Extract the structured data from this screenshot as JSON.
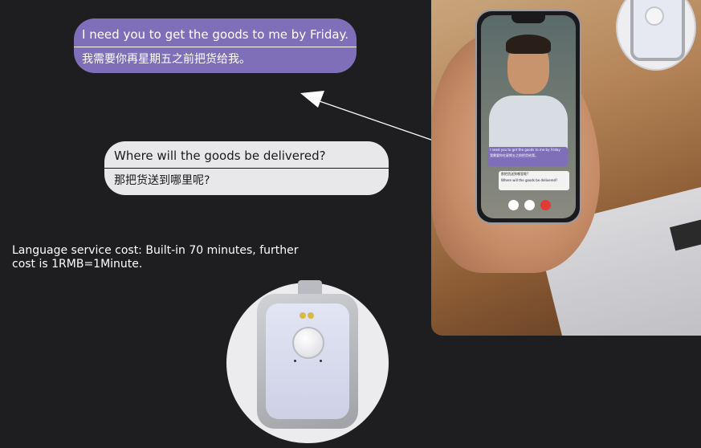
{
  "bubbles": {
    "outgoing": {
      "english": "I need you to get the goods to me by Friday.",
      "chinese": "我需要你再星期五之前把货给我。",
      "color": "#7e6fb8"
    },
    "incoming": {
      "english": "Where will the goods be delivered?",
      "chinese": "那把货送到哪里呢?",
      "color": "#e8e8ea"
    }
  },
  "cost_text": "Language service cost: Built-in 70 minutes, further cost is 1RMB=1Minute.",
  "phone_screen": {
    "mini_outgoing_en": "I need you to get the goods to me by Friday",
    "mini_outgoing_zh": "我需要你在星期五之前把货给我。",
    "mini_incoming_zh": "那把货送到哪里呢?",
    "mini_incoming_en": "Where will the goods be delivered?",
    "icons": [
      "microphone-icon",
      "camera-icon",
      "end-call-icon"
    ]
  },
  "colors": {
    "background": "#1e1d1f",
    "accent_purple": "#7e6fb8",
    "end_call_red": "#e23a35"
  }
}
